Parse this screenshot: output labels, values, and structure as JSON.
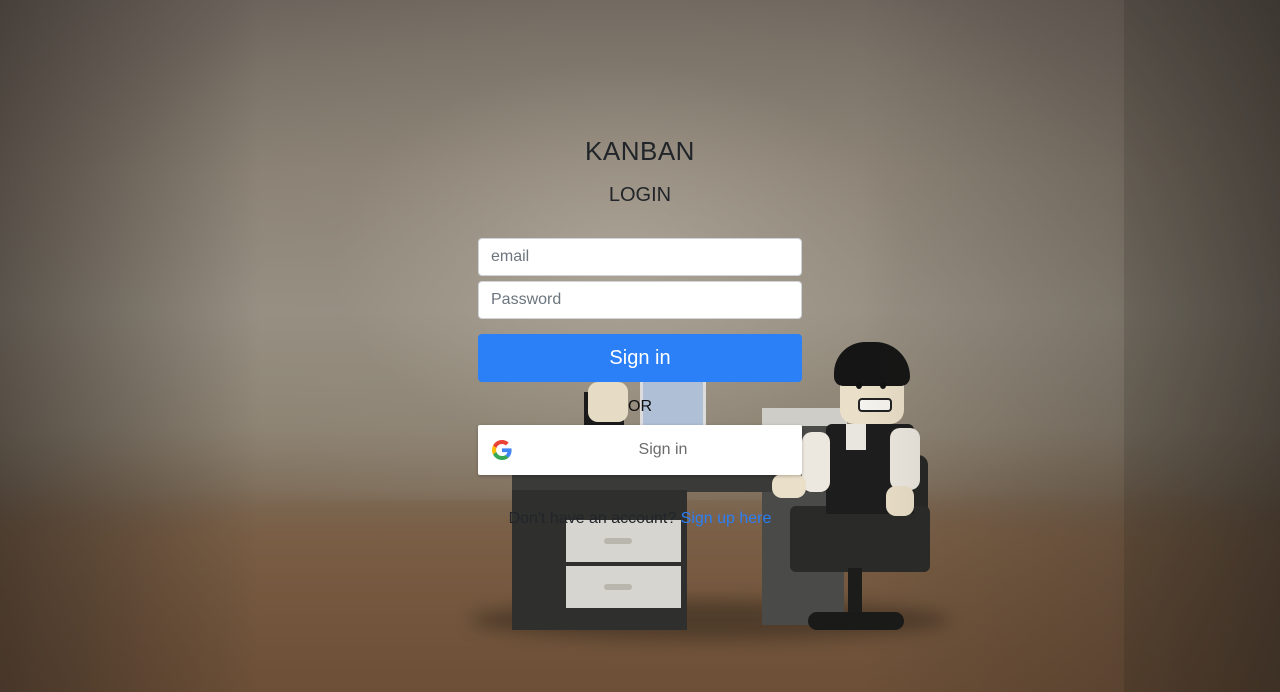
{
  "app": {
    "title": "KANBAN"
  },
  "login": {
    "heading": "LOGIN",
    "email_placeholder": "email",
    "password_placeholder": "Password",
    "signin_label": "Sign in",
    "or_label": "OR",
    "google_signin_label": "Sign in",
    "signup_prompt": "Don't have an account?",
    "signup_link": "Sign up here"
  },
  "icons": {
    "google": "google-g-logo"
  },
  "colors": {
    "primary": "#2b7ff7",
    "text": "#212529",
    "google_text": "#6b6b6b"
  }
}
